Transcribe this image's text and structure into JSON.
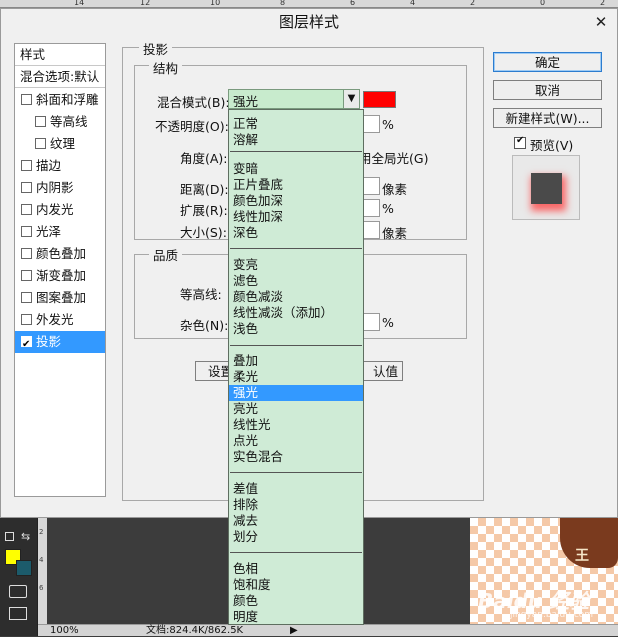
{
  "ruler": {
    "marks": [
      "14",
      "12",
      "10",
      "8",
      "6",
      "4",
      "2",
      "0",
      "2"
    ]
  },
  "dialog": {
    "title": "图层样式",
    "close_glyph": "✕",
    "style_list": {
      "header": "样式",
      "blend_options": "混合选项:默认",
      "items": [
        {
          "label": "斜面和浮雕",
          "checked": false
        },
        {
          "label": "等高线",
          "checked": false
        },
        {
          "label": "纹理",
          "checked": false
        },
        {
          "label": "描边",
          "checked": false
        },
        {
          "label": "内阴影",
          "checked": false
        },
        {
          "label": "内发光",
          "checked": false
        },
        {
          "label": "光泽",
          "checked": false
        },
        {
          "label": "颜色叠加",
          "checked": false
        },
        {
          "label": "渐变叠加",
          "checked": false
        },
        {
          "label": "图案叠加",
          "checked": false
        },
        {
          "label": "外发光",
          "checked": false
        },
        {
          "label": "投影",
          "checked": true
        }
      ]
    },
    "drop_shadow": {
      "group_title": "投影",
      "structure_title": "结构",
      "blend_mode_label": "混合模式(B):",
      "blend_mode_value": "强光",
      "shadow_color": "#ff0000",
      "opacity_label": "不透明度(O):",
      "opacity_unit": "%",
      "angle_label": "角度(A):",
      "global_light_label": "用全局光(G)",
      "distance_label": "距离(D):",
      "distance_unit": "像素",
      "spread_label": "扩展(R):",
      "spread_unit": "%",
      "size_label": "大小(S):",
      "size_unit": "像素",
      "quality_title": "品质",
      "contour_label": "等高线:",
      "noise_label": "杂色(N):",
      "noise_unit": "%",
      "set_default_partial": "设置",
      "reset_default_partial": "认值"
    },
    "buttons": {
      "ok": "确定",
      "cancel": "取消",
      "new_style": "新建样式(W)...",
      "preview_label": "预览(V)",
      "preview_checked": true
    },
    "blend_dropdown": {
      "selected": "强光",
      "groups": [
        [
          "正常",
          "溶解"
        ],
        [
          "变暗",
          "正片叠底",
          "颜色加深",
          "线性加深",
          "深色"
        ],
        [
          "变亮",
          "滤色",
          "颜色减淡",
          "线性减淡（添加）",
          "浅色"
        ],
        [
          "叠加",
          "柔光",
          "强光",
          "亮光",
          "线性光",
          "点光",
          "实色混合"
        ],
        [
          "差值",
          "排除",
          "减去",
          "划分"
        ],
        [
          "色相",
          "饱和度",
          "颜色",
          "明度"
        ]
      ]
    }
  },
  "photoshop": {
    "foreground_color": "#ffff00",
    "background_color": "#1c5b6b",
    "vertical_ruler_marks": [
      "2",
      "4",
      "6"
    ],
    "canvas_art_text": "王",
    "watermark": "Baidu 经验",
    "watermark_sub": "jingyan.baidu.com",
    "status": {
      "zoom": "100%",
      "doc": "文档:824.4K/862.5K",
      "arrow": "▶"
    }
  }
}
